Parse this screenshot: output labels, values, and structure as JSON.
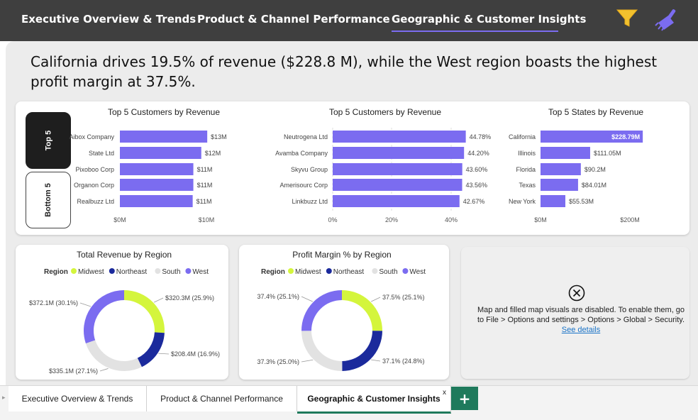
{
  "nav": {
    "tabs": [
      {
        "label": "Executive Overview & Trends"
      },
      {
        "label": "Product & Channel Performance"
      },
      {
        "label": "Geographic & Customer Insights",
        "active": true
      }
    ],
    "icons": {
      "filter": "filter-icon",
      "clear": "broom-icon"
    }
  },
  "headline": "California drives 19.5% of revenue ($228.8 M), while the West region boasts the highest profit margin at 37.5%.",
  "toggle": {
    "top": "Top 5",
    "bottom": "Bottom 5"
  },
  "chart_data": [
    {
      "type": "bar",
      "title": "Top 5 Customers by Revenue",
      "categories": [
        "Aibox Company",
        "State Ltd",
        "Pixoboo Corp",
        "Organon Corp",
        "Realbuzz Ltd"
      ],
      "values": [
        13.2,
        12.3,
        11.1,
        11.1,
        11.0
      ],
      "value_labels": [
        "$13M",
        "$12M",
        "$11M",
        "$11M",
        "$11M"
      ],
      "xticks": [
        "$0M",
        "$10M"
      ],
      "xlim": [
        0,
        15
      ],
      "color": "#7b6cf0"
    },
    {
      "type": "bar",
      "title": "Top 5 Customers by Revenue",
      "categories": [
        "Neutrogena Ltd",
        "Avamba Company",
        "Skyvu Group",
        "Amerisourc Corp",
        "Linkbuzz Ltd"
      ],
      "values": [
        44.78,
        44.2,
        43.6,
        43.56,
        42.67
      ],
      "value_labels": [
        "44.78%",
        "44.20%",
        "43.60%",
        "43.56%",
        "42.67%"
      ],
      "xticks": [
        "0%",
        "20%",
        "40%"
      ],
      "xlim": [
        0,
        50
      ],
      "color": "#7b6cf0"
    },
    {
      "type": "bar",
      "title": "Top 5 States by Revenue",
      "categories": [
        "California",
        "Illinois",
        "Florida",
        "Texas",
        "New York"
      ],
      "values": [
        228.79,
        111.05,
        90.2,
        84.01,
        55.53
      ],
      "value_labels": [
        "$228.79M",
        "$111.05M",
        "$90.2M",
        "$84.01M",
        "$55.53M"
      ],
      "xticks": [
        "$0M",
        "$200M"
      ],
      "xlim": [
        0,
        250
      ],
      "color": "#7b6cf0"
    },
    {
      "type": "pie",
      "title": "Total Revenue by Region",
      "legend_title": "Region",
      "categories": [
        "Midwest",
        "Northeast",
        "South",
        "West"
      ],
      "values": [
        25.9,
        16.9,
        27.1,
        30.1
      ],
      "value_labels": [
        "$320.3M (25.9%)",
        "$208.4M (16.9%)",
        "$335.1M (27.1%)",
        "$372.1M (30.1%)"
      ],
      "colors": [
        "#d4f53c",
        "#1b2a9c",
        "#e2e2e2",
        "#7b6cf0"
      ]
    },
    {
      "type": "pie",
      "title": "Profit Margin % by Region",
      "legend_title": "Region",
      "categories": [
        "Midwest",
        "Northeast",
        "South",
        "West"
      ],
      "values": [
        25.1,
        24.8,
        25.0,
        25.1
      ],
      "value_labels": [
        "37.5% (25.1%)",
        "37.1% (24.8%)",
        "37.3% (25.0%)",
        "37.4% (25.1%)"
      ],
      "colors": [
        "#d4f53c",
        "#1b2a9c",
        "#e2e2e2",
        "#7b6cf0"
      ]
    }
  ],
  "map_card": {
    "icon": "close-circle-icon",
    "message": "Map and filled map visuals are disabled. To enable them, go to File > Options and settings > Options > Global > Security.",
    "link": "See details"
  },
  "sheets": {
    "tabs": [
      {
        "label": "Executive Overview & Trends"
      },
      {
        "label": "Product & Channel Performance"
      },
      {
        "label": "Geographic & Customer Insights",
        "active": true
      }
    ],
    "close_label": "x",
    "add_label": "+"
  },
  "colors": {
    "accent": "#7b6cf0",
    "topbar": "#3f3f3f",
    "filter": "#f2c12e",
    "sheet_active": "#1f7a5c"
  }
}
